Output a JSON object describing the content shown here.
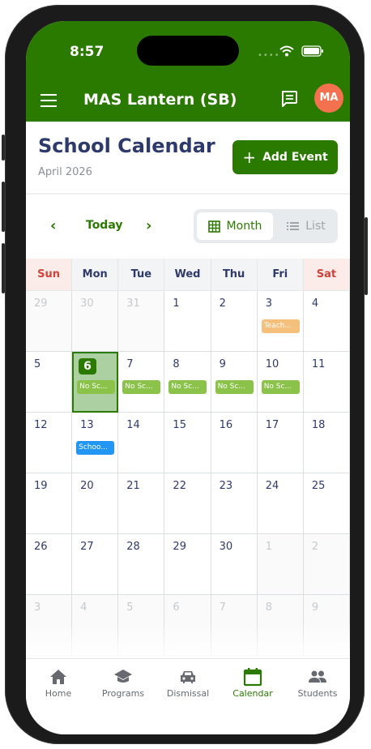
{
  "status": {
    "time": "8:57"
  },
  "app": {
    "title": "MAS Lantern (SB)",
    "avatar_initials": "MA"
  },
  "page": {
    "title": "School Calendar",
    "month": "April 2026",
    "add_event": "Add Event"
  },
  "nav": {
    "today": "Today",
    "month": "Month",
    "list": "List"
  },
  "weekdays": [
    "Sun",
    "Mon",
    "Tue",
    "Wed",
    "Thu",
    "Fri",
    "Sat"
  ],
  "weeks": [
    [
      {
        "d": "29",
        "out": true
      },
      {
        "d": "30",
        "out": true
      },
      {
        "d": "31",
        "out": true
      },
      {
        "d": "1"
      },
      {
        "d": "2"
      },
      {
        "d": "3",
        "event": "Teach...",
        "color": "#f4c07c"
      },
      {
        "d": "4"
      }
    ],
    [
      {
        "d": "5"
      },
      {
        "d": "6",
        "today": true,
        "event": "No Sc...",
        "color": "#8bc34a"
      },
      {
        "d": "7",
        "event": "No Sc...",
        "color": "#8bc34a"
      },
      {
        "d": "8",
        "event": "No Sc...",
        "color": "#8bc34a"
      },
      {
        "d": "9",
        "event": "No Sc...",
        "color": "#8bc34a"
      },
      {
        "d": "10",
        "event": "No Sc...",
        "color": "#8bc34a"
      },
      {
        "d": "11"
      }
    ],
    [
      {
        "d": "12"
      },
      {
        "d": "13",
        "event": "Schoo...",
        "color": "#2196f3"
      },
      {
        "d": "14"
      },
      {
        "d": "15"
      },
      {
        "d": "16"
      },
      {
        "d": "17"
      },
      {
        "d": "18"
      }
    ],
    [
      {
        "d": "19"
      },
      {
        "d": "20"
      },
      {
        "d": "21"
      },
      {
        "d": "22"
      },
      {
        "d": "23"
      },
      {
        "d": "24"
      },
      {
        "d": "25"
      }
    ],
    [
      {
        "d": "26"
      },
      {
        "d": "27"
      },
      {
        "d": "28"
      },
      {
        "d": "29"
      },
      {
        "d": "30"
      },
      {
        "d": "1",
        "out": true
      },
      {
        "d": "2",
        "out": true
      }
    ],
    [
      {
        "d": "3",
        "out": true
      },
      {
        "d": "4",
        "out": true
      },
      {
        "d": "5",
        "out": true
      },
      {
        "d": "6",
        "out": true
      },
      {
        "d": "7",
        "out": true
      },
      {
        "d": "8",
        "out": true
      },
      {
        "d": "9",
        "out": true
      }
    ]
  ],
  "tabs": [
    {
      "label": "Home",
      "icon": "home-icon"
    },
    {
      "label": "Programs",
      "icon": "graduation-cap-icon"
    },
    {
      "label": "Dismissal",
      "icon": "car-icon"
    },
    {
      "label": "Calendar",
      "icon": "calendar-icon",
      "active": true
    },
    {
      "label": "Students",
      "icon": "people-icon"
    }
  ],
  "colors": {
    "brand": "#2a7a00",
    "avatar": "#f4714f",
    "weekend_text": "#d0433a"
  }
}
